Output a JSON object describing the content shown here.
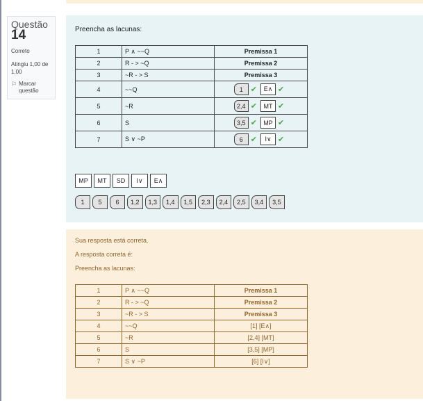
{
  "info": {
    "question_word": "Questão",
    "question_number": "14",
    "state": "Correto",
    "grade": "Atingiu 1,00 de 1,00",
    "flag_label": "Marcar questão"
  },
  "formulation": {
    "prompt": "Preencha as lacunas:",
    "rows": [
      {
        "n": "1",
        "f": "P ∧ ~~Q",
        "j": "Premissa 1"
      },
      {
        "n": "2",
        "f": "R - > ~Q",
        "j": "Premissa 2"
      },
      {
        "n": "3",
        "f": "~R - > S",
        "j": "Premissa 3"
      },
      {
        "n": "4",
        "f": "~~Q",
        "ref": "1",
        "rule": "E∧"
      },
      {
        "n": "5",
        "f": "~R",
        "ref": "2,4",
        "rule": "MT"
      },
      {
        "n": "6",
        "f": "S",
        "ref": "3,5",
        "rule": "MP"
      },
      {
        "n": "7",
        "f": "S ∨ ~P",
        "ref": "6",
        "rule": "I∨"
      }
    ],
    "check_icon": "check-icon",
    "check_color": "#4fa24f",
    "drag_rules": [
      "MP",
      "MT",
      "SD",
      "I∨",
      "E∧"
    ],
    "drag_numbers": [
      "1",
      "5",
      "6",
      "1,2",
      "1,3",
      "1,4",
      "1,5",
      "2,3",
      "2,4",
      "2,5",
      "3,4",
      "3,5"
    ]
  },
  "feedback": {
    "correct_msg": "Sua resposta está correta.",
    "right_answer_intro": "A resposta correta é:",
    "prompt": "Preencha as lacunas:",
    "rows": [
      {
        "n": "1",
        "f": "P ∧ ~~Q",
        "j": "Premissa 1"
      },
      {
        "n": "2",
        "f": "R - > ~Q",
        "j": "Premissa 2"
      },
      {
        "n": "3",
        "f": "~R - > S",
        "j": "Premissa 3"
      },
      {
        "n": "4",
        "f": "~~Q",
        "a": "[1] [E∧]"
      },
      {
        "n": "5",
        "f": "~R",
        "a": "[2,4] [MT]"
      },
      {
        "n": "6",
        "f": "S",
        "a": "[3,5] [MP]"
      },
      {
        "n": "7",
        "f": "S ∨ ~P",
        "a": "[6] [I∨]"
      }
    ],
    "text_color": "#8e662e",
    "bg_color": "#fcefdc"
  }
}
